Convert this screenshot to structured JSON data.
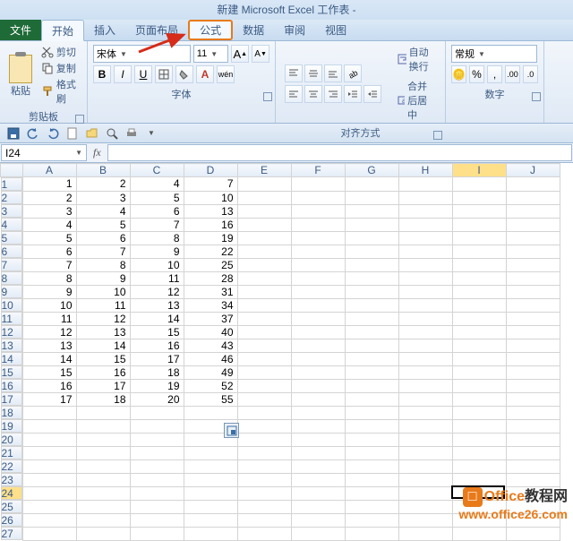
{
  "title": "新建 Microsoft Excel 工作表 -",
  "tabs": {
    "file": "文件",
    "home": "开始",
    "insert": "插入",
    "layout": "页面布局",
    "formulas": "公式",
    "data": "数据",
    "review": "审阅",
    "view": "视图"
  },
  "clipboard": {
    "paste": "粘贴",
    "cut": "剪切",
    "copy": "复制",
    "format_painter": "格式刷",
    "group": "剪贴板"
  },
  "font": {
    "name": "宋体",
    "size": "11",
    "bold": "B",
    "italic": "I",
    "underline": "U",
    "group": "字体",
    "grow": "A",
    "shrink": "A"
  },
  "alignment": {
    "wrap": "自动换行",
    "merge": "合并后居中",
    "group": "对齐方式"
  },
  "number": {
    "format": "常规",
    "group": "数字"
  },
  "namebox": "I24",
  "fx": "fx",
  "columns": [
    "A",
    "B",
    "C",
    "D",
    "E",
    "F",
    "G",
    "H",
    "I",
    "J"
  ],
  "active_col_index": 8,
  "active_row": 24,
  "row_count": 27,
  "chart_data": {
    "type": "table",
    "columns": [
      "A",
      "B",
      "C",
      "D"
    ],
    "rows": [
      [
        1,
        2,
        4,
        7
      ],
      [
        2,
        3,
        5,
        10
      ],
      [
        3,
        4,
        6,
        13
      ],
      [
        4,
        5,
        7,
        16
      ],
      [
        5,
        6,
        8,
        19
      ],
      [
        6,
        7,
        9,
        22
      ],
      [
        7,
        8,
        10,
        25
      ],
      [
        8,
        9,
        11,
        28
      ],
      [
        9,
        10,
        12,
        31
      ],
      [
        10,
        11,
        13,
        34
      ],
      [
        11,
        12,
        14,
        37
      ],
      [
        12,
        13,
        15,
        40
      ],
      [
        13,
        14,
        16,
        43
      ],
      [
        14,
        15,
        17,
        46
      ],
      [
        15,
        16,
        18,
        49
      ],
      [
        16,
        17,
        19,
        52
      ],
      [
        17,
        18,
        20,
        55
      ]
    ]
  },
  "watermark": {
    "line1_pre": "",
    "line1_brand": "Office",
    "line1_post": "教程网",
    "line2": "www.office26.com"
  }
}
